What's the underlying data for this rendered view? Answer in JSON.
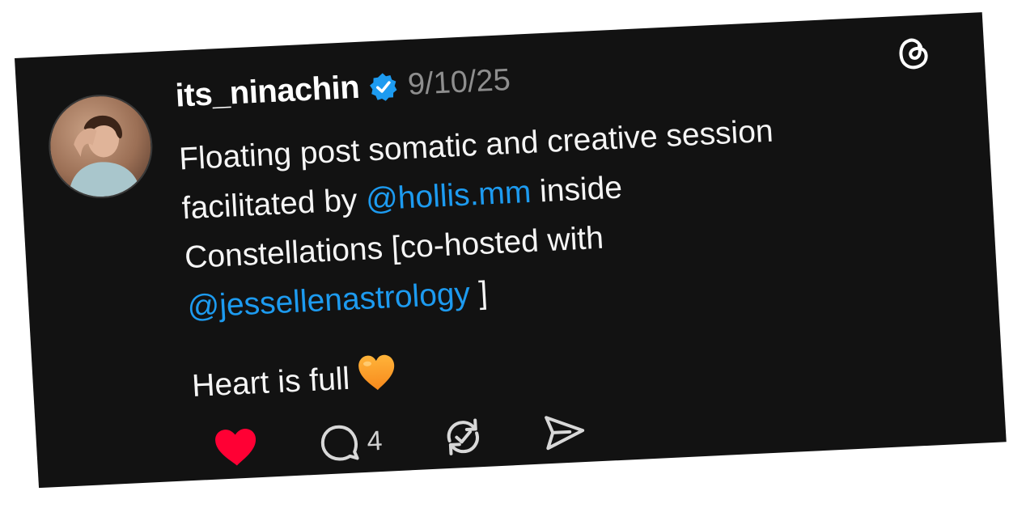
{
  "post": {
    "username": "its_ninachin",
    "date": "9/10/25",
    "verified": true,
    "text": {
      "line1": "Floating post somatic and creative session",
      "line2_prefix": "facilitated by ",
      "mention1": "@hollis.mm",
      "line2_suffix": "  inside",
      "line3": "Constellations [co-hosted with",
      "mention2": "@jessellenastrology",
      "line4_suffix": " ]",
      "line5": "Heart is full"
    },
    "icons": {
      "logo": "threads-logo-icon",
      "verified": "verified-badge-icon",
      "emoji": "orange-heart-emoji",
      "like": "heart-icon",
      "reply": "comment-bubble-icon",
      "repost": "repost-icon",
      "share": "send-icon"
    },
    "actions": {
      "liked": true,
      "reply_count": "4"
    },
    "colors": {
      "background": "#121212",
      "mention": "#1d9bf0",
      "like": "#ff0034",
      "verified": "#1d9bf0"
    }
  }
}
